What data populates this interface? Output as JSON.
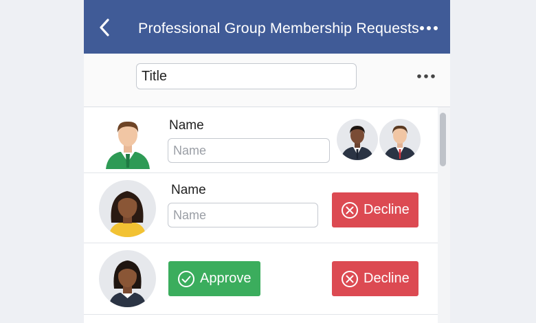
{
  "header": {
    "title": "Professional Group Membership Requests",
    "back_icon": "chevron-left-icon",
    "more_icon": "more-horizontal-icon",
    "color": "#405b97"
  },
  "toolbar": {
    "title_placeholder": "Title",
    "more_icon": "more-horizontal-icon"
  },
  "requests": [
    {
      "label": "Name",
      "input_placeholder": "Name",
      "mutual_members": [
        "member-avatar",
        "member-avatar"
      ]
    },
    {
      "label": "Name",
      "input_placeholder": "Name",
      "decline_label": "Decline"
    },
    {
      "approve_label": "Approve",
      "decline_label": "Decline"
    }
  ],
  "colors": {
    "approve": "#3bad5d",
    "decline": "#dc4a52",
    "background": "#eef0f4"
  }
}
